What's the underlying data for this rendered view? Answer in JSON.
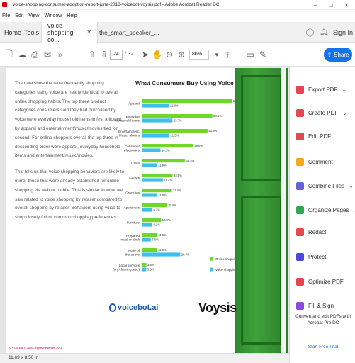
{
  "window": {
    "title": "voice-shopping-consumer-adoption-report-june-2018-voicebot-voysis.pdf - Adobe Acrobat Reader DC"
  },
  "menu": [
    "File",
    "Edit",
    "View",
    "Window",
    "Help"
  ],
  "tabs": {
    "home": "Home",
    "tools": "Tools",
    "doc1": "voice-shopping-co...",
    "doc2": "the_smart_speaker_...",
    "signin": "Sign In"
  },
  "toolbar": {
    "page_current": "24",
    "page_total": "/ 32",
    "zoom": "86%",
    "share": "Share"
  },
  "doc": {
    "para1": "The data show the most frequently shopping categories using voice are nearly identical to overall online shopping habits. The top three product categories consumers said they had purchased by voice were everyday household items in first followed by apparel and entertainment/music/movies tied for second. For online shoppers overall the top three in descending order were apparel, everyday household items and entertainment/music/movies.",
    "para2": "This tells us that voice shopping behaviors are likely to mirror those that were already established for online shopping via web or mobile. This is similar to what we saw related to voice shopping by retailer compared to overall shopping by retailer. Behaviors using voice to shop closely follow common shopping preferences.",
    "footer": "© VOICEBOT.AI All Rights Reserved 2018",
    "size_label": "11.69 x 8.50 in"
  },
  "chart_data": {
    "type": "bar",
    "title": "What Consumers Buy Using Voice",
    "categories": [
      "Apparel",
      "Everyday household items",
      "Entertainment, Music, Movies",
      "Consumer electronics",
      "Travel",
      "Games",
      "Groceries",
      "Appliances",
      "Furniture",
      "Prepared meal or drink",
      "None of the above",
      "Local services (dry cleaning, etc.)"
    ],
    "category_lines": [
      [
        "Apparel"
      ],
      [
        "Everyday",
        "household items"
      ],
      [
        "Entertainment,",
        "Music, Movies"
      ],
      [
        "Consumer",
        "electronics"
      ],
      [
        "Travel"
      ],
      [
        "Games"
      ],
      [
        "Groceries"
      ],
      [
        "Appliances"
      ],
      [
        "Furniture"
      ],
      [
        "Prepared",
        "meal or drink"
      ],
      [
        "None of",
        "the above"
      ],
      [
        "Local services",
        "(dry cleaning, etc.)"
      ]
    ],
    "series": [
      {
        "name": "Online shopping",
        "color": "#6fd62a",
        "values": [
          69.6,
          54.5,
          50.8,
          39.8,
          33.3,
          23.8,
          23.2,
          19.4,
          14.8,
          11.9,
          11.8,
          3.6
        ],
        "labels": [
          "69.6%",
          "54.5%",
          "50.8%",
          "39.8%",
          "33.3%",
          "23.8%",
          "23.2%",
          "19.4%",
          "14.8%",
          "11.9%",
          "11.8%",
          "3.6%"
        ]
      },
      {
        "name": "Voice shopping",
        "color": "#3ec0ea",
        "values": [
          21.0,
          23.7,
          21.3,
          14.5,
          11.9,
          16.4,
          11.8,
          8.2,
          8.2,
          7.0,
          29.7,
          3.5
        ],
        "labels": [
          "21.0%",
          "23.7%",
          "21.3%",
          "14.5%",
          "11.9%",
          "16.4%",
          "11.8%",
          "8.2%",
          "8.2%",
          "7.0%",
          "29.7%",
          "3.5%"
        ]
      }
    ],
    "xlim": [
      0,
      70
    ],
    "grid": false,
    "legend": "bottom-right"
  },
  "logos": {
    "voicebot": "voicebot.ai",
    "voysis": "Voysis"
  },
  "rightpanel": {
    "items": [
      {
        "label": "Export PDF",
        "color": "#e34850",
        "chev": "⌄"
      },
      {
        "label": "Create PDF",
        "color": "#e34850",
        "chev": "⌄"
      },
      {
        "label": "Edit PDF",
        "color": "#e34850",
        "chev": ""
      },
      {
        "label": "Comment",
        "color": "#f5a623",
        "chev": ""
      },
      {
        "label": "Combine Files",
        "color": "#6b5fd6",
        "chev": "⌄"
      },
      {
        "label": "Organize Pages",
        "color": "#2fa84f",
        "chev": "⌄"
      },
      {
        "label": "Redact",
        "color": "#e34850",
        "chev": ""
      },
      {
        "label": "Protect",
        "color": "#4b4bd6",
        "chev": ""
      },
      {
        "label": "Optimize PDF",
        "color": "#e34850",
        "chev": ""
      },
      {
        "label": "Fill & Sign",
        "color": "#8a4bd6",
        "chev": ""
      }
    ],
    "convert_text": "Convert and edit PDFs with Acrobat Pro DC",
    "trial": "Start Free Trial"
  }
}
